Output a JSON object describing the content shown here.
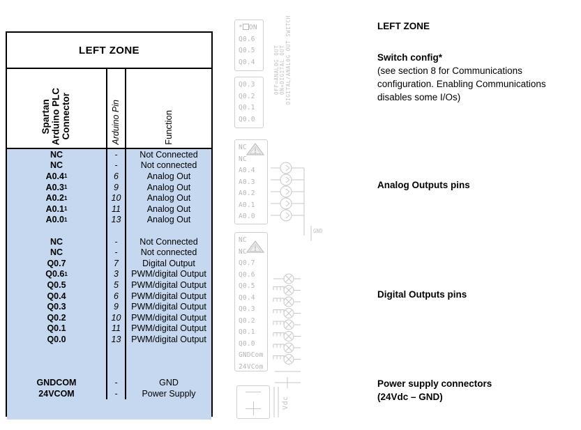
{
  "table": {
    "title": "LEFT ZONE",
    "headers": {
      "connector": "Spartan\nArduino PLC\nConnector",
      "pin": "Arduino Pin",
      "function": "Function"
    },
    "rows": [
      {
        "connector": "NC",
        "sup": "",
        "pin": "-",
        "function": "Not Connected"
      },
      {
        "connector": "NC",
        "sup": "",
        "pin": "-",
        "function": "Not connected"
      },
      {
        "connector": "A0.4",
        "sup": "1",
        "pin": "6",
        "function": "Analog Out"
      },
      {
        "connector": "A0.3",
        "sup": "1",
        "pin": "9",
        "function": "Analog Out"
      },
      {
        "connector": "A0.2",
        "sup": "1",
        "pin": "10",
        "function": "Analog Out"
      },
      {
        "connector": "A0.1",
        "sup": "1",
        "pin": "11",
        "function": "Analog Out"
      },
      {
        "connector": "A0.0",
        "sup": "1",
        "pin": "13",
        "function": "Analog Out"
      },
      {
        "connector": "",
        "sup": "",
        "pin": "",
        "function": ""
      },
      {
        "connector": "NC",
        "sup": "",
        "pin": "-",
        "function": "Not Connected"
      },
      {
        "connector": "NC",
        "sup": "",
        "pin": "-",
        "function": "Not connected"
      },
      {
        "connector": "Q0.7",
        "sup": "",
        "pin": "7",
        "function": "Digital Output"
      },
      {
        "connector": "Q0.6",
        "sup": "1",
        "pin": "3",
        "function": "PWM/digital Output"
      },
      {
        "connector": "Q0.5",
        "sup": "",
        "pin": "5",
        "function": "PWM/digital Output"
      },
      {
        "connector": "Q0.4",
        "sup": "",
        "pin": "6",
        "function": "PWM/digital Output"
      },
      {
        "connector": "Q0.3",
        "sup": "",
        "pin": "9",
        "function": "PWM/digital Output"
      },
      {
        "connector": "Q0.2",
        "sup": "",
        "pin": "10",
        "function": "PWM/digital Output"
      },
      {
        "connector": "Q0.1",
        "sup": "",
        "pin": "11",
        "function": "PWM/digital Output"
      },
      {
        "connector": "Q0.0",
        "sup": "",
        "pin": "13",
        "function": "PWM/digital Output"
      },
      {
        "connector": "",
        "sup": "",
        "pin": "",
        "function": ""
      },
      {
        "connector": "",
        "sup": "",
        "pin": "",
        "function": ""
      },
      {
        "connector": "",
        "sup": "",
        "pin": "",
        "function": ""
      },
      {
        "connector": "GNDCOM",
        "sup": "",
        "pin": "-",
        "function": "GND"
      },
      {
        "connector": "24VCOM",
        "sup": "",
        "pin": "-",
        "function": "Power Supply"
      }
    ],
    "row_fill_color": "#c5d8ef"
  },
  "diagram": {
    "switch_block_top": [
      "*ON",
      "Q0.6",
      "Q0.5",
      "Q0.4"
    ],
    "switch_block_bottom": [
      "Q0.3",
      "Q0.2",
      "Q0.1",
      "Q0.0"
    ],
    "switch_label_main": "DIGITAL/ANALOG OUT SWITCH",
    "switch_label_on": "ON=DIGITAL OUT",
    "switch_label_off": "OFF=ANALOG OUT",
    "analog_block": [
      "NC",
      "NC",
      "A0.4",
      "A0.3",
      "A0.2",
      "A0.1",
      "A0.0"
    ],
    "analog_gnd_label": "GND",
    "digital_block": [
      "NC",
      "NC",
      "Q0.7",
      "Q0.6",
      "Q0.5",
      "Q0.4",
      "Q0.3",
      "Q0.2",
      "Q0.1",
      "Q0.0",
      "GNDCom",
      "24VCom"
    ],
    "power_block": {
      "minus": "—",
      "plus": "+",
      "label": "Vdc"
    },
    "line_color": "#c7c7c7",
    "text_color": "#b5b5b5"
  },
  "notes": [
    {
      "heading": "LEFT ZONE",
      "body": ""
    },
    {
      "heading": "Switch config*",
      "body": "(see section 8 for Communications configuration. Enabling Communications disables some  I/Os)"
    },
    {
      "heading": "Analog Outputs pins",
      "body": ""
    },
    {
      "heading": "Digital Outputs pins",
      "body": ""
    },
    {
      "heading": "Power supply connectors",
      "body": "(24Vdc – GND)"
    }
  ]
}
